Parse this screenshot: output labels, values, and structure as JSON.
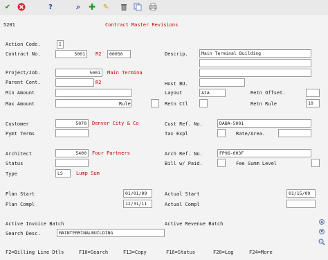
{
  "toolbar": {
    "icons": [
      "ok-check-icon",
      "cancel-x-icon",
      "help-question-icon",
      "find-icon",
      "add-plus-icon",
      "edit-pencil-icon",
      "delete-trash-icon",
      "copy-icon",
      "print-icon"
    ]
  },
  "header": {
    "form_id": "5201",
    "title": "Contract Master Revisions"
  },
  "fields": {
    "action_code": {
      "label": "Action Code.",
      "value": "I"
    },
    "contract_no": {
      "label": "Contract No.",
      "value": "5001",
      "code": "R2",
      "value2": "00050"
    },
    "description": {
      "label": "Descrip.",
      "value": "Main Terminal Building"
    },
    "project_job": {
      "label": "Project/Job.",
      "value": "5001",
      "name": "Main Termina"
    },
    "parent_cont": {
      "label": "Parent Cont.",
      "code": "R2"
    },
    "host_bu": {
      "label": "Host BU."
    },
    "min_amount": {
      "label": "Min Amount"
    },
    "layout": {
      "label": "Layout",
      "value": "AIA"
    },
    "retn_offset": {
      "label": "Retn Offset."
    },
    "max_amount": {
      "label": "Max Amount"
    },
    "rule": {
      "label": "Rule"
    },
    "retn_ctl": {
      "label": "Retn Ctl"
    },
    "retn_rule": {
      "label": "Retn Rule",
      "value": "10"
    },
    "customer": {
      "label": "Customer",
      "value": "5070",
      "name": "Denver City & Co"
    },
    "cust_ref_no": {
      "label": "Cust Ref. No.",
      "value": "DABA-5001"
    },
    "pymt_terms": {
      "label": "Pymt Terms"
    },
    "tax_expl": {
      "label": "Tax Expl"
    },
    "rate_area": {
      "label": "Rate/Area."
    },
    "architect": {
      "label": "Architect",
      "value": "5400",
      "name": "Four Partners"
    },
    "arch_ref_no": {
      "label": "Arch Ref. No.",
      "value": "FP96-003F"
    },
    "status": {
      "label": "Status"
    },
    "bill_w_paid": {
      "label": "Bill w/ Paid."
    },
    "fee_summ_level": {
      "label": "Fee Summ Level"
    },
    "type": {
      "label": "Type",
      "value": "LS",
      "name": "Lump Sum"
    },
    "plan_start": {
      "label": "Plan Start",
      "value": "01/01/09"
    },
    "actual_start": {
      "label": "Actual Start",
      "value": "01/15/09"
    },
    "plan_compl": {
      "label": "Plan Compl",
      "value": "12/31/11"
    },
    "actual_compl": {
      "label": "Actual Compl"
    },
    "active_invoice_batch": {
      "label": "Active Invoice Batch"
    },
    "active_revenue_batch": {
      "label": "Active Revenue Batch"
    },
    "search_desc": {
      "label": "Search Desc.",
      "value": "MAINTERMINALBUILDING"
    }
  },
  "function_keys": [
    "F2=Billing Line Dtls",
    "F10=Search",
    "F13=Copy",
    "F16=Status",
    "F20=Log",
    "F24=More"
  ],
  "colors": {
    "accent_red": "#c00000",
    "background": "#f3f3f3",
    "field_bg": "#ffffff"
  }
}
